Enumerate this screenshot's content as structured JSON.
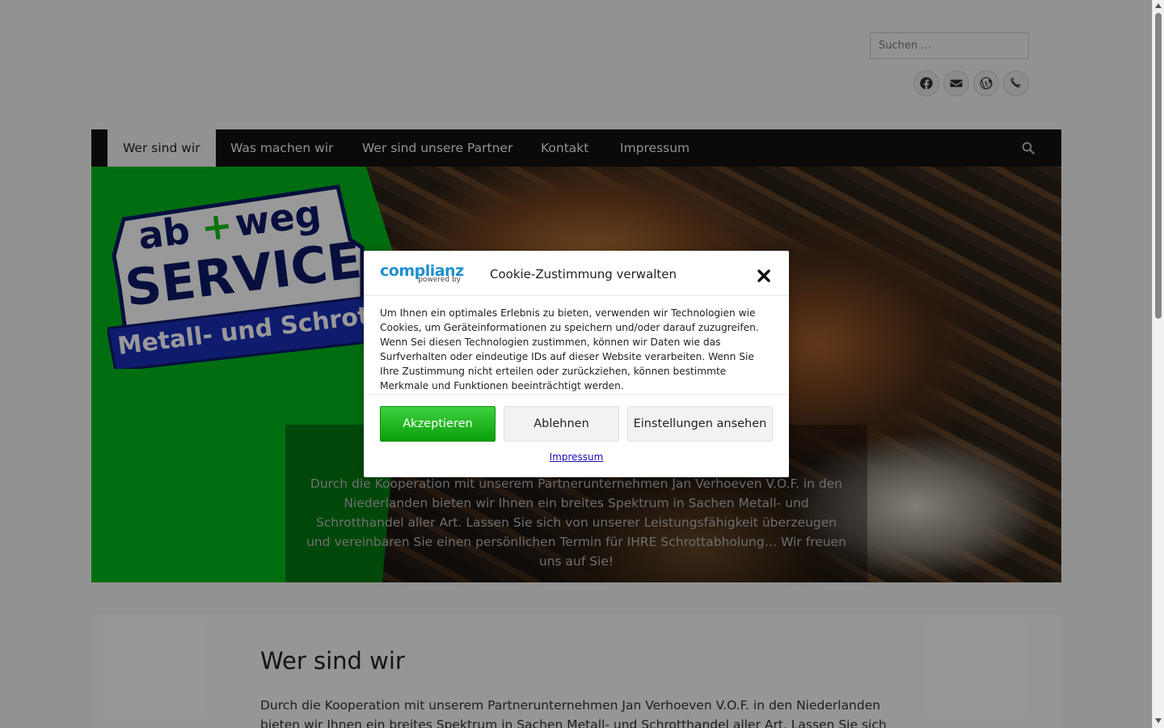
{
  "header": {
    "search_placeholder": "Suchen …",
    "social_icons": [
      "facebook-icon",
      "email-icon",
      "wordpress-icon",
      "phone-icon"
    ]
  },
  "nav": {
    "items": [
      {
        "label": "Wer sind wir",
        "active": true
      },
      {
        "label": "Was machen wir",
        "active": false
      },
      {
        "label": "Wer sind unsere Partner",
        "active": false
      },
      {
        "label": "Kontakt",
        "active": false
      },
      {
        "label": "Impressum",
        "active": false
      }
    ]
  },
  "hero": {
    "logo_line1": "ab",
    "logo_plus": "+",
    "logo_line1b": "weg",
    "logo_line2": "SERVICE",
    "logo_line3": "Metall- und Schrotth",
    "text": "Durch die Kooperation mit unserem Partnerunternehmen Jan Verhoeven V.O.F. in den Niederlanden bieten wir Ihnen ein breites Spektrum in Sachen Metall- und Schrotthandel aller Art. Lassen Sie sich von unserer Leistungsfähigkeit überzeugen und vereinbaren Sie einen persönlichen Termin für IHRE Schrottabholung… Wir freuen uns auf Sie!"
  },
  "content": {
    "title": "Wer sind wir",
    "text": "Durch die Kooperation mit unserem Partnerunternehmen Jan Verhoeven V.O.F. in den Niederlanden bieten wir Ihnen ein breites Spektrum in Sachen Metall- und Schrotthandel aller Art. Lassen Sie sich von unserer Leistungsfähigkeit überzeugen"
  },
  "cookie": {
    "brand": "complianz",
    "brand_sub": "powered by",
    "title": "Cookie-Zustimmung verwalten",
    "body": "Um Ihnen ein optimales Erlebnis zu bieten, verwenden wir Technologien wie Cookies, um Geräteinformationen zu speichern und/oder darauf zuzugreifen. Wenn Sei diesen Technologien zustimmen, können wir Daten wie das Surfverhalten oder eindeutige IDs auf dieser Website verarbeiten. Wenn Sie Ihre Zustimmung nicht erteilen oder zurückziehen, können bestimmte Merkmale und Funktionen beeinträchtigt werden.",
    "accept": "Akzeptieren",
    "deny": "Ablehnen",
    "preferences": "Einstellungen ansehen",
    "link": "Impressum"
  },
  "colors": {
    "accent_green": "#00b81c",
    "brand_blue": "#1e8fd0",
    "nav_bg": "#111111"
  }
}
